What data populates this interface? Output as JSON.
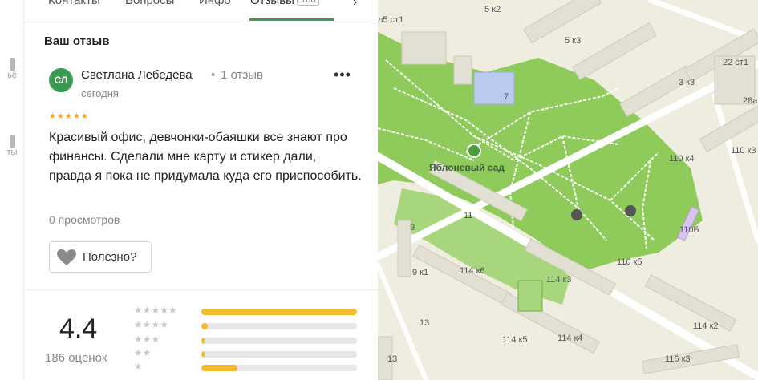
{
  "rail": {
    "items": [
      {
        "label": "ьё"
      },
      {
        "label": "ты"
      }
    ]
  },
  "tabs": {
    "items": [
      {
        "label": "Контакты"
      },
      {
        "label": "Вопросы"
      },
      {
        "label": "Инфо"
      },
      {
        "label": "Отзывы"
      }
    ],
    "reviews_count": "186",
    "active": "Отзывы"
  },
  "review": {
    "section_title": "Ваш отзыв",
    "avatar_initials": "СЛ",
    "author": "Светлана Лебедева",
    "separator": "•",
    "author_reviews": "1 отзыв",
    "date": "сегодня",
    "stars": 5,
    "stars_text": "★★★★★",
    "menu_label": "•••",
    "text": "Красивый офис, девчонки-обаяшки все знают про финансы. Сделали мне карту и стикер дали, правда я пока не придумала куда его приспособить.",
    "views": "0 просмотров",
    "useful_label": "Полезно?",
    "heart_icon": "heart-icon"
  },
  "rating": {
    "value": "4.4",
    "count_label": "186 оценок",
    "distribution": [
      {
        "stars": "★★★★★",
        "fraction": 1.0
      },
      {
        "stars": "★★★★",
        "fraction": 0.04
      },
      {
        "stars": "★★★",
        "fraction": 0.02
      },
      {
        "stars": "★★",
        "fraction": 0.02
      },
      {
        "stars": "★",
        "fraction": 0.23
      }
    ]
  },
  "map": {
    "park_name": "Яблоневый сад",
    "labels": [
      "5 к2",
      "5 к3",
      "3 к3",
      "22 ст1",
      "28а",
      "110 к3",
      "110 к4",
      "110 к5",
      "110Б",
      "11",
      "9",
      "9 к1",
      "114 к6",
      "114 к3",
      "114 к5",
      "114 к4",
      "114 к2",
      "116 к3",
      "13",
      "13",
      "7",
      "л5 ст1"
    ],
    "colors": {
      "park": "#8ecb5a",
      "ground": "#efece0",
      "building": "#e0ddd0",
      "road": "#ffffff",
      "school": "#b9c9ef"
    }
  }
}
